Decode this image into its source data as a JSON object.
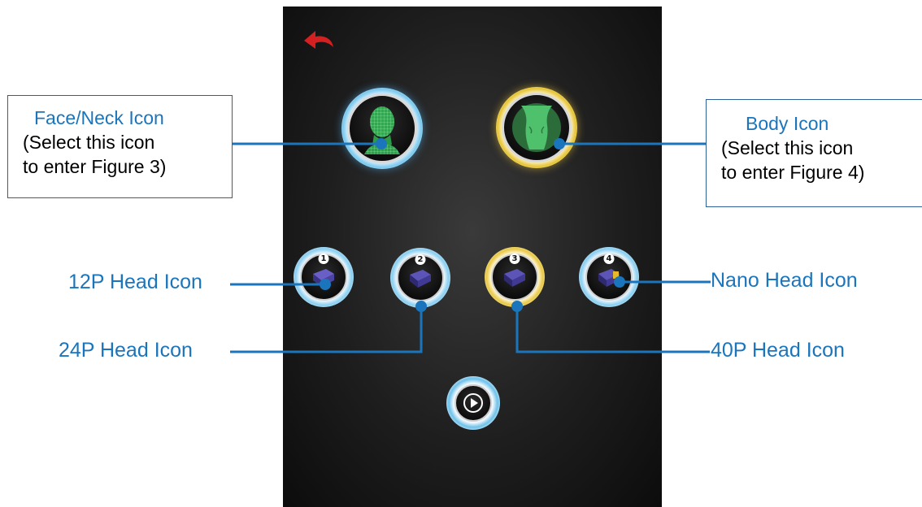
{
  "callouts": {
    "face": {
      "title": "Face/Neck Icon",
      "line1": "(Select this icon",
      "line2": "to enter Figure 3)"
    },
    "body": {
      "title": "Body Icon",
      "line1": "(Select this icon",
      "line2": "to enter Figure 4)"
    }
  },
  "labels": {
    "head12": "12P Head Icon",
    "head24": "24P Head Icon",
    "head40": "40P Head Icon",
    "nano": "Nano Head Icon"
  },
  "heads": [
    {
      "number": "1",
      "ring": "blue"
    },
    {
      "number": "2",
      "ring": "blue"
    },
    {
      "number": "3",
      "ring": "yellow"
    },
    {
      "number": "4",
      "ring": "blue"
    }
  ],
  "icons": {
    "back": "back-arrow-icon",
    "face": "face-wireframe-icon",
    "body": "body-torso-icon",
    "play": "play-icon"
  },
  "colors": {
    "label_blue": "#1b75bc",
    "leader_line": "#1b75bc",
    "back_arrow": "#d42020",
    "ring_blue": "#42ace3",
    "ring_yellow": "#d3a21a",
    "figure_green": "#3fbf5f"
  }
}
